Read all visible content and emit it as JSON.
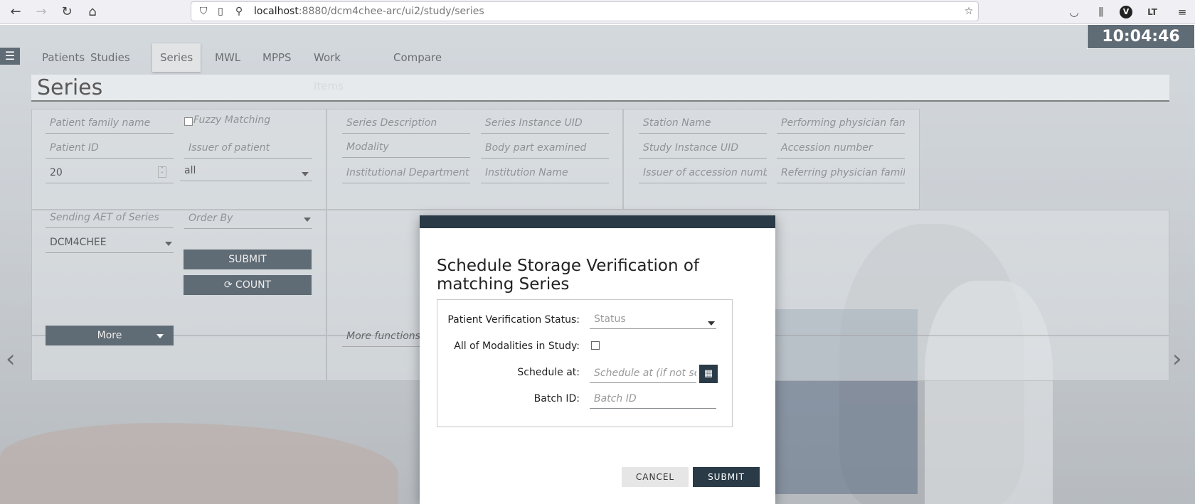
{
  "browser": {
    "url_host": "localhost",
    "url_rest": ":8880/dcm4chee-arc/ui2/study/series",
    "avatar_letter": "V"
  },
  "app": {
    "clock": "10:04:46",
    "tabs": [
      "Patients",
      "Studies",
      "Series",
      "MWL",
      "MPPS",
      "Work Items",
      "Compare"
    ],
    "active_tab": "Series",
    "page_title": "Series"
  },
  "filters": {
    "patient_family_name": "Patient family name",
    "fuzzy_matching": "Fuzzy Matching",
    "patient_id": "Patient ID",
    "issuer_of_patient": "Issuer of patient",
    "limit_value": "20",
    "issuer_select_value": "all",
    "series_description": "Series Description",
    "series_instance_uid": "Series Instance UID",
    "modality": "Modality",
    "body_part_examined": "Body part examined",
    "institutional_department": "Institutional Department N",
    "institution_name": "Institution Name",
    "station_name": "Station Name",
    "performing_physician": "Performing physician fami",
    "study_instance_uid": "Study Instance UID",
    "accession_number": "Accession number",
    "issuer_of_accession": "Issuer of accession numbe",
    "referring_physician": "Referring physician family",
    "sending_aet": "Sending AET of Series",
    "order_by": "Order By",
    "aet_value": "DCM4CHEE",
    "submit_label": "SUBMIT",
    "count_label": "COUNT",
    "more_label": "More",
    "more_functions": "More functions"
  },
  "modal": {
    "title": "Schedule Storage Verification of matching Series",
    "patient_verification_label": "Patient Verification Status:",
    "status_placeholder": "Status",
    "all_modalities_label": "All of Modalities in Study:",
    "schedule_at_label": "Schedule at:",
    "schedule_at_placeholder": "Schedule at (if not set,",
    "batch_id_label": "Batch ID:",
    "batch_id_placeholder": "Batch ID",
    "cancel_label": "CANCEL",
    "submit_label": "SUBMIT"
  },
  "colors": {
    "primary_dark": "#2a3a47"
  }
}
